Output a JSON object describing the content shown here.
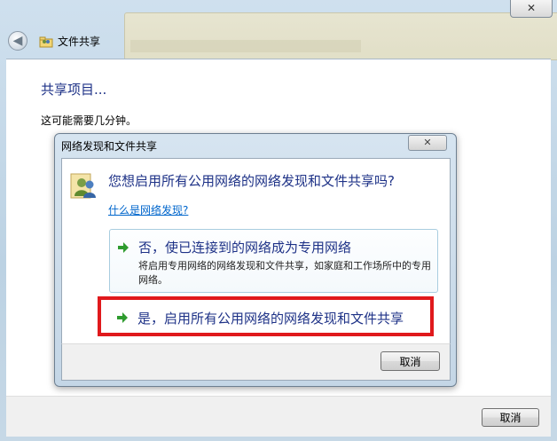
{
  "window": {
    "title": "文件共享",
    "close_glyph": "✕",
    "back_glyph": "◀"
  },
  "main": {
    "heading": "共享项目...",
    "subtext": "这可能需要几分钟。",
    "cancel_label": "取消"
  },
  "dialog": {
    "title": "网络发现和文件共享",
    "close_glyph": "✕",
    "question": "您想启用所有公用网络的网络发现和文件共享吗?",
    "help_link": "什么是网络发现?",
    "options": [
      {
        "title": "否，使已连接到的网络成为专用网络",
        "description": "将启用专用网络的网络发现和文件共享，如家庭和工作场所中的专用网络。"
      },
      {
        "title": "是，启用所有公用网络的网络发现和文件共享",
        "description": ""
      }
    ],
    "cancel_label": "取消"
  },
  "colors": {
    "accent_text": "#1e3287",
    "link": "#0066cc",
    "highlight_border": "#e0191c",
    "arrow_green": "#2e9b2e"
  },
  "icons": [
    "back-arrow-icon",
    "wizard-share-icon",
    "users-icon",
    "green-arrow-icon",
    "close-icon"
  ]
}
